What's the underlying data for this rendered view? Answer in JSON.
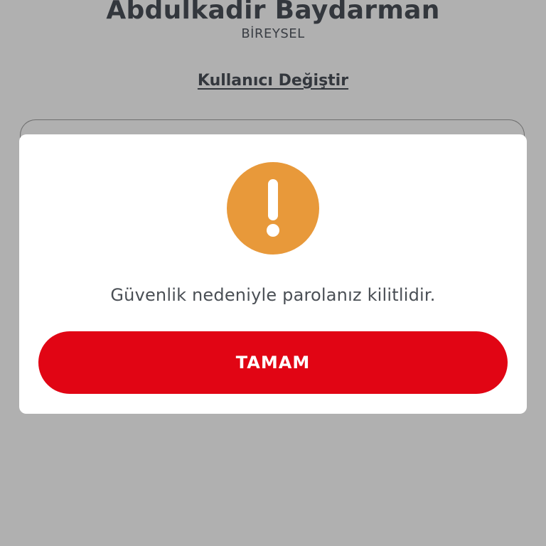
{
  "header": {
    "user_name": "Abdulkadir Baydarman",
    "user_type": "BİREYSEL",
    "switch_user_label": "Kullanıcı Değiştir"
  },
  "dialog": {
    "icon": "exclamation-icon",
    "message": "Güvenlik nedeniyle parolanız kilitlidir.",
    "ok_label": "TAMAM"
  },
  "colors": {
    "background_overlay": "#b0b0b0",
    "dialog_bg": "#ffffff",
    "warning_orange": "#e8993a",
    "button_red": "#e10514",
    "text_dark": "#33373d",
    "message_text": "#4a4f55"
  }
}
